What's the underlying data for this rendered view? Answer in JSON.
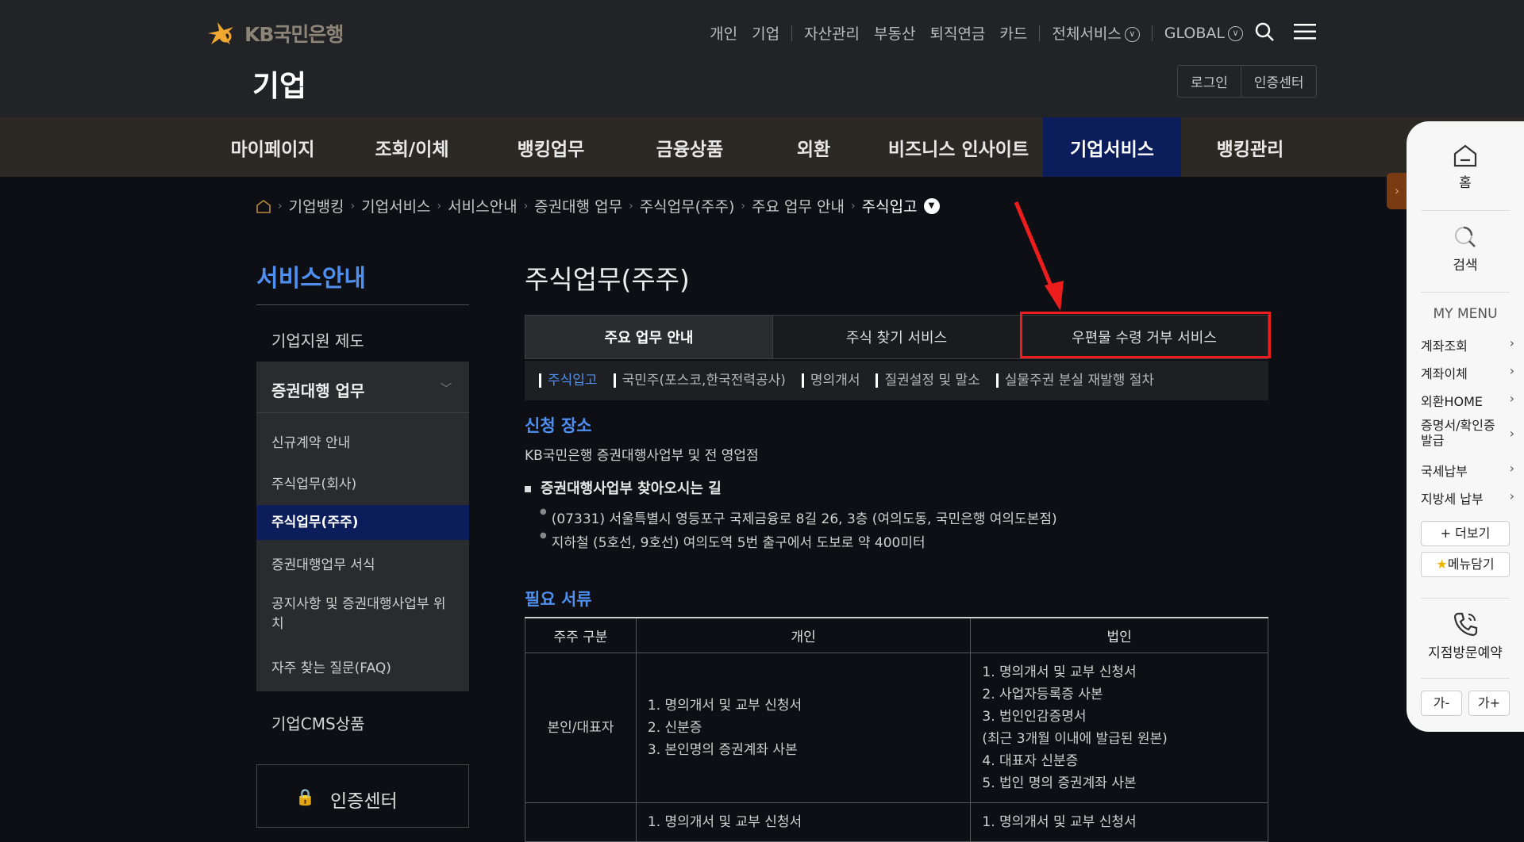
{
  "header": {
    "logo_text": "KB국민은행",
    "brand_sub": "기업",
    "topnav": [
      "개인",
      "기업",
      "자산관리",
      "부동산",
      "퇴직연금",
      "카드",
      "전체서비스",
      "GLOBAL"
    ],
    "login": "로그인",
    "cert_center": "인증센터",
    "icons": [
      "search-icon",
      "hamburger-icon"
    ]
  },
  "gnb": {
    "items": [
      "마이페이지",
      "조회/이체",
      "뱅킹업무",
      "금융상품",
      "외환",
      "비즈니스 인사이트",
      "기업서비스",
      "뱅킹관리"
    ],
    "active": "기업서비스",
    "active_color": "#0b1e5b"
  },
  "breadcrumb": [
    "기업뱅킹",
    "기업서비스",
    "서비스안내",
    "증권대행 업무",
    "주식업무(주주)",
    "주요 업무 안내",
    "주식입고"
  ],
  "lnb": {
    "title": "서비스안내",
    "items": [
      "기업지원 제도",
      "증권대행 업무",
      "기업CMS상품"
    ],
    "sub_items": [
      "신규계약 안내",
      "주식업무(회사)",
      "주식업무(주주)",
      "증권대행업무 서식",
      "공지사항 및 증권대행사업부 위치",
      "자주 찾는 질문(FAQ)"
    ],
    "active_sub": "주식업무(주주)",
    "cert_center": "인증센터"
  },
  "content": {
    "page_title": "주식업무(주주)",
    "tabs": [
      "주요 업무 안내",
      "주식 찾기 서비스",
      "우편물 수령 거부 서비스"
    ],
    "subtabs": [
      "주식입고",
      "국민주(포스코,한국전력공사)",
      "명의개서",
      "질권설정 및 말소",
      "실물주권 분실 재발행 절차"
    ],
    "section1_title": "신청 장소",
    "section1_text": "KB국민은행 증권대행사업부 및 전 영업점",
    "directions_title": "증권대행사업부 찾아오시는 길",
    "directions": [
      "(07331) 서울특별시 영등포구 국제금융로 8길 26, 3층 (여의도동, 국민은행 여의도본점)",
      "지하철 (5호선, 9호선) 여의도역 5번 출구에서 도보로 약 400미터"
    ],
    "section2_title": "필요 서류",
    "table": {
      "headers": [
        "주주 구분",
        "개인",
        "법인"
      ],
      "rows": [
        {
          "type": "본인/대표자",
          "individual": [
            "1. 명의개서 및 교부 신청서",
            "2. 신분증",
            "3. 본인명의 증권계좌 사본"
          ],
          "corporate": [
            "1. 명의개서 및 교부 신청서",
            "2. 사업자등록증 사본",
            "3. 법인인감증명서",
            "(최근 3개월 이내에 발급된 원본)",
            "4. 대표자 신분증",
            "5. 법인 명의 증권계좌 사본"
          ]
        },
        {
          "type": "",
          "individual": [
            "1. 명의개서 및 교부 신청서"
          ],
          "corporate": [
            "1. 명의개서 및 교부 신청서"
          ]
        }
      ]
    }
  },
  "quick_menu": {
    "home": "홈",
    "search": "검색",
    "my_menu_title": "MY MENU",
    "items": [
      "계좌조회",
      "계좌이체",
      "외환HOME",
      "증명서/확인증 발급",
      "국세납부",
      "지방세 납부"
    ],
    "more": "더보기",
    "save_menu": "메뉴담기",
    "branch_visit": "지점방문예약",
    "font_minus": "가-",
    "font_plus": "가+"
  },
  "colors": {
    "accent_blue": "#4e8ff0",
    "annotation_red": "#ee1d1d",
    "logo_star": "#f0a830"
  }
}
